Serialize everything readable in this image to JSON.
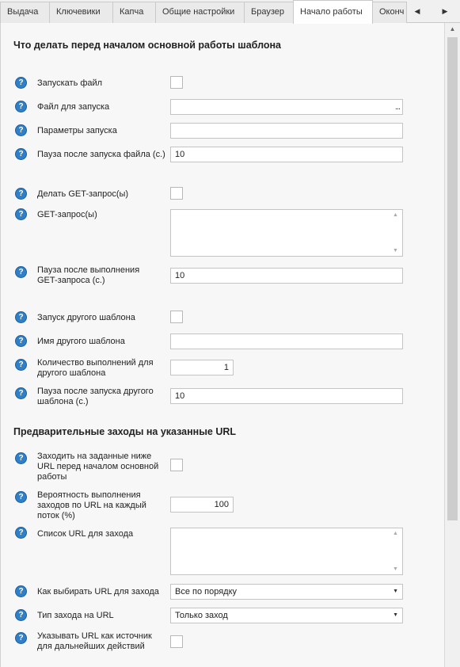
{
  "tabs": [
    {
      "label": "Выдача"
    },
    {
      "label": "Ключевики"
    },
    {
      "label": "Капча"
    },
    {
      "label": "Общие настройки"
    },
    {
      "label": "Браузер"
    },
    {
      "label": "Начало работы",
      "active": true
    },
    {
      "label": "Оконч"
    }
  ],
  "section1": {
    "title": "Что делать перед началом основной работы шаблона",
    "run_file_label": "Запускать файл",
    "file_label": "Файл для запуска",
    "file_value": "",
    "file_button": "...",
    "params_label": "Параметры запуска",
    "params_value": "",
    "pause_file_label": "Пауза после запуска файла (с.)",
    "pause_file_value": "10",
    "get_enable_label": "Делать GET-запрос(ы)",
    "get_label": "GET-запрос(ы)",
    "get_value": "",
    "pause_get_label": "Пауза после выполнения GET-запроса (с.)",
    "pause_get_value": "10",
    "run_tpl_label": "Запуск другого шаблона",
    "tpl_name_label": "Имя другого шаблона",
    "tpl_name_value": "",
    "tpl_count_label": "Количество выполнений для другого шаблона",
    "tpl_count_value": "1",
    "pause_tpl_label": "Пауза после запуска другого шаблона (с.)",
    "pause_tpl_value": "10"
  },
  "section2": {
    "title": "Предварительные заходы на указанные URL",
    "visit_label": "Заходить на заданные ниже URL перед началом основной работы",
    "prob_label": "Вероятность выполнения заходов по URL на каждый поток (%)",
    "prob_value": "100",
    "url_list_label": "Список URL для захода",
    "url_list_value": "",
    "choose_label": "Как выбирать URL для захода",
    "choose_value": "Все по порядку",
    "type_label": "Тип захода на URL",
    "type_value": "Только заход",
    "referrer_label": "Указывать URL как источник для дальнейших действий"
  },
  "icons": {
    "help": "?",
    "tab_prev": "◀",
    "tab_next": "▶",
    "scroll_up": "▲",
    "dropdown": "▼"
  },
  "colors": {
    "help_icon": "#2f7fc9",
    "panel_bg": "#f7f7f7",
    "active_tab_bg": "#ffffff"
  }
}
